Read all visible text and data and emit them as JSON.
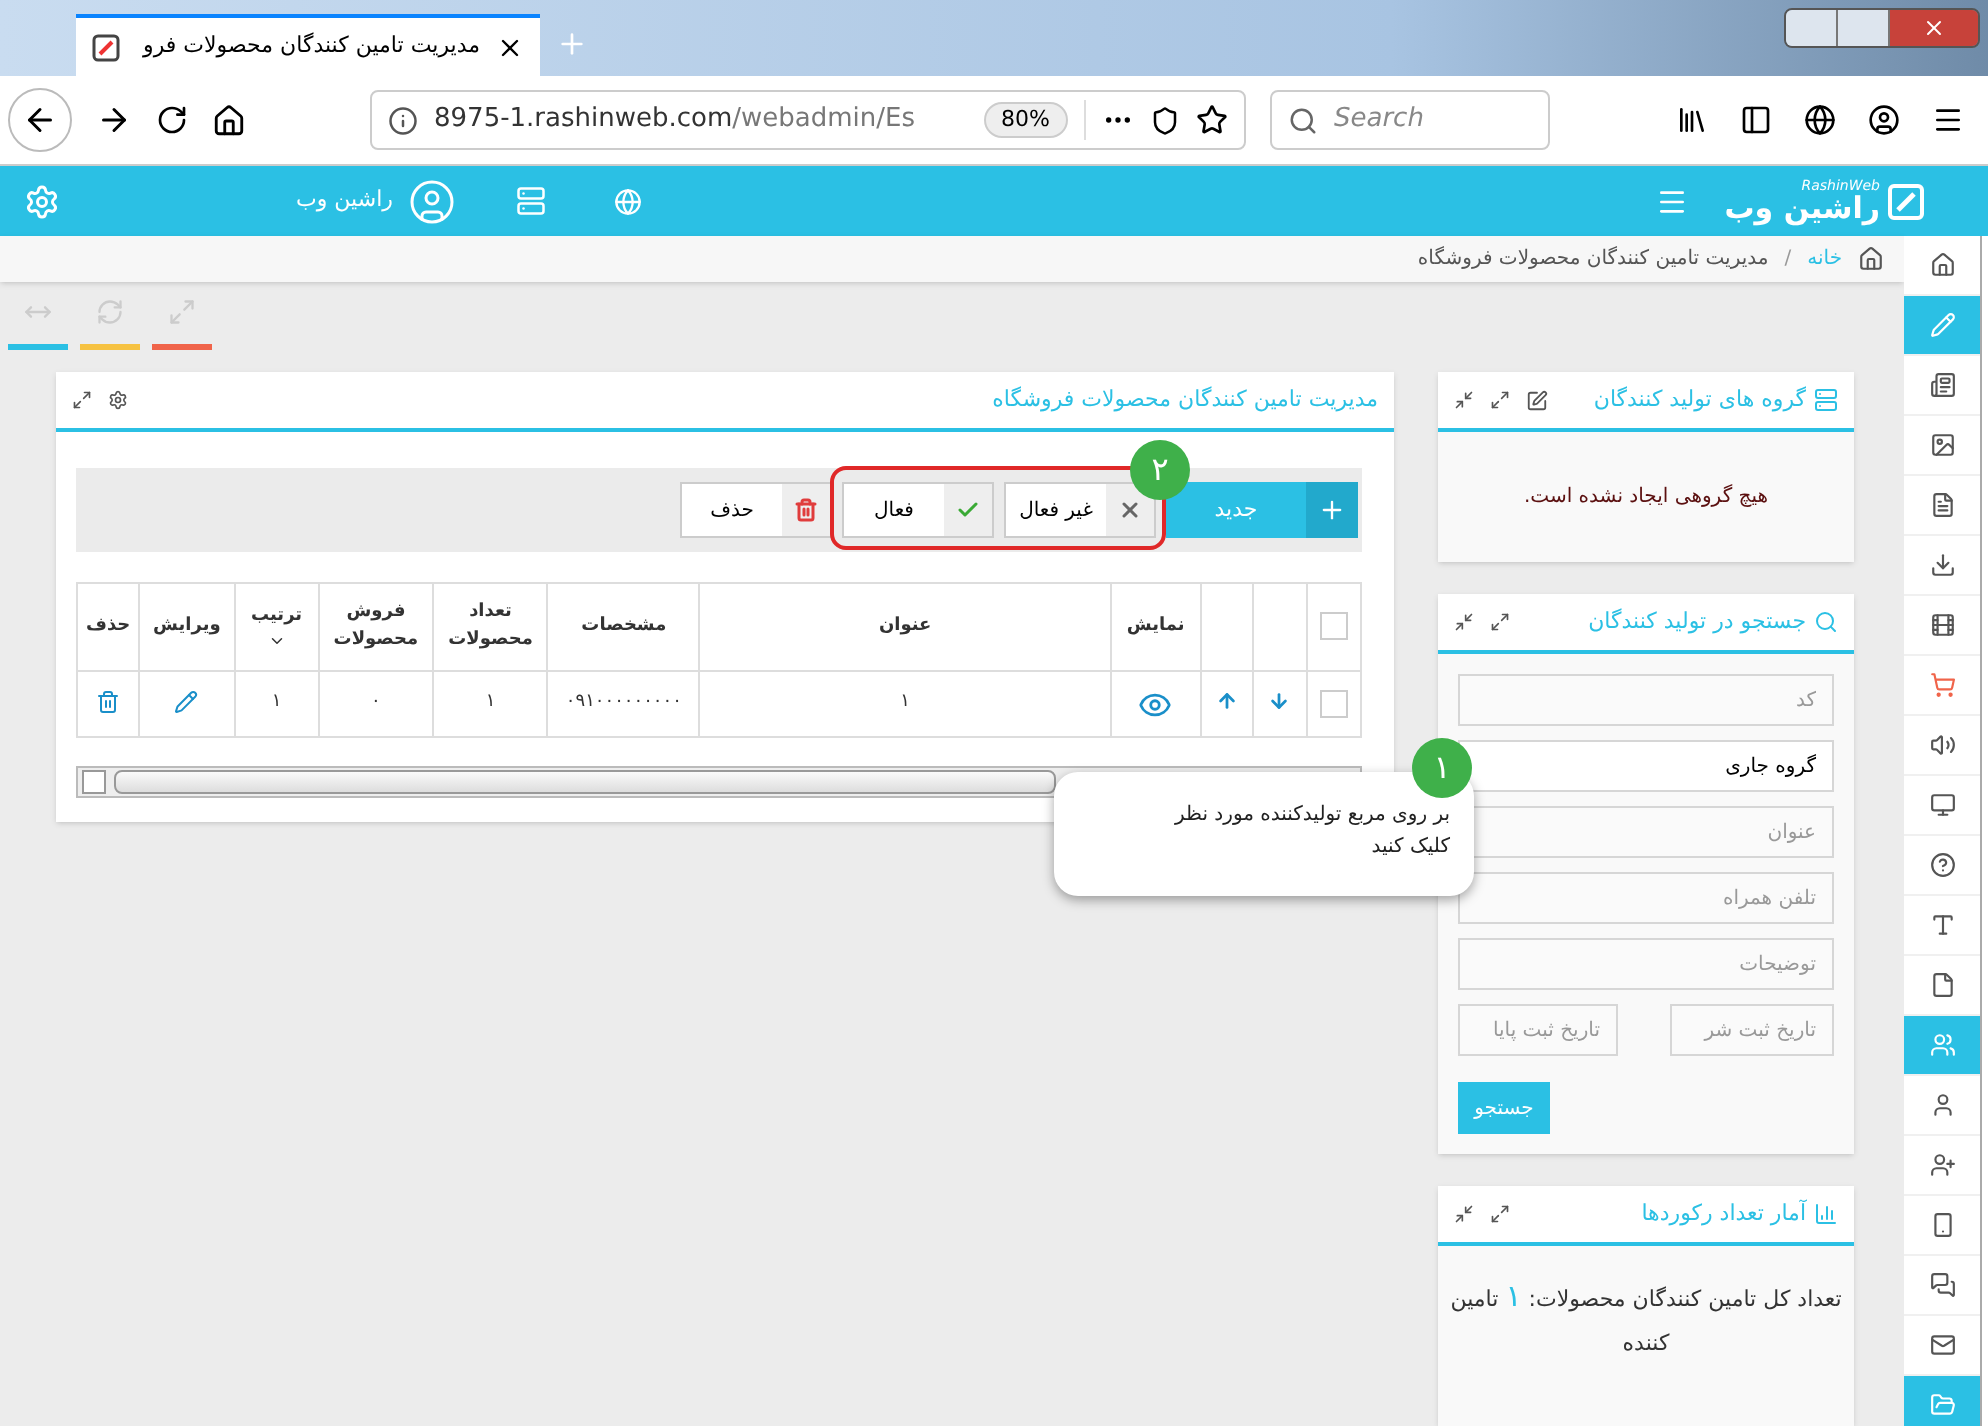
{
  "browser": {
    "tab_title": "مدیریت تامین کنندگان محصولات فرو",
    "url_host": "8975-1.rashinweb.com",
    "url_path": "/webadmin/Es",
    "zoom": "80%",
    "search_placeholder": "Search"
  },
  "header": {
    "logo_text": "راشین وب",
    "logo_sub": "RashinWeb",
    "user_name": "راشین وب"
  },
  "breadcrumb": {
    "home": "خانه",
    "separator": "/",
    "current": "مدیریت تامین کنندگان محصولات فروشگاه"
  },
  "toolbar": [
    {
      "kind": "arrows",
      "color": "#2bc0e4"
    },
    {
      "kind": "refresh",
      "color": "#f6c242"
    },
    {
      "kind": "expand",
      "color": "#f0644a"
    }
  ],
  "main_panel": {
    "title": "مدیریت تامین کنندگان محصولات فروشگاه",
    "actions": [
      {
        "kind": "new",
        "label": "جدید"
      },
      {
        "kind": "inactive",
        "label": "غیر فعال"
      },
      {
        "kind": "active",
        "label": "فعال"
      },
      {
        "kind": "delete",
        "label": "حذف"
      }
    ],
    "highlight_badge": "۲",
    "columns": [
      {
        "kind": "checkbox",
        "checked": false
      },
      {
        "kind": "blank"
      },
      {
        "kind": "blank"
      },
      {
        "kind": "text",
        "label": "نمایش"
      },
      {
        "kind": "text",
        "label": "عنوان"
      },
      {
        "kind": "text",
        "label": "مشخصات"
      },
      {
        "kind": "text",
        "label": "تعداد محصولات"
      },
      {
        "kind": "text",
        "label": "فروش محصولات"
      },
      {
        "kind": "sortable",
        "label": "ترتیب"
      },
      {
        "kind": "text",
        "label": "ویرایش"
      },
      {
        "kind": "text",
        "label": "حذف"
      }
    ],
    "rows": [
      {
        "checked": false,
        "title": "۱",
        "specs": "۰۹۱۰۰۰۰۰۰۰۰۰",
        "product_count": "۱",
        "sales": "۰",
        "order": "۱"
      }
    ]
  },
  "tooltip": {
    "badge": "۱",
    "text": "بر روی مربع تولیدکننده مورد نظر کلیک کنید"
  },
  "groups_panel": {
    "title": "گروه های تولید کنندگان",
    "message": "هیچ گروهی ایجاد نشده است."
  },
  "search_panel": {
    "title": "جستجو در تولید کنندگان",
    "code_placeholder": "کد",
    "group_value": "گروه جاری",
    "title_placeholder": "عنوان",
    "mobile_placeholder": "تلفن همراه",
    "notes_placeholder": "توضیحات",
    "date_from_placeholder": "تاریخ ثبت شر",
    "date_to_placeholder": "تاریخ ثبت پایا",
    "button": "جستجو"
  },
  "stats_panel": {
    "title": "آمار تعداد رکوردها",
    "text_before": "تعداد کل تامین کنندگان محصولات:",
    "count": "۱",
    "text_after": "تامین کننده"
  },
  "sidebar": [
    {
      "kind": "home",
      "selected": false
    },
    {
      "kind": "pencil",
      "selected": true
    },
    {
      "kind": "news",
      "selected": false
    },
    {
      "kind": "image",
      "selected": false
    },
    {
      "kind": "document",
      "selected": false
    },
    {
      "kind": "download",
      "selected": false
    },
    {
      "kind": "film",
      "selected": false
    },
    {
      "kind": "cart",
      "selected": false
    },
    {
      "kind": "sound",
      "selected": false
    },
    {
      "kind": "monitor",
      "selected": false
    },
    {
      "kind": "help",
      "selected": false
    },
    {
      "kind": "text",
      "selected": false
    },
    {
      "kind": "file",
      "selected": false
    },
    {
      "kind": "users",
      "selected": true
    },
    {
      "kind": "user",
      "selected": false
    },
    {
      "kind": "user-plus",
      "selected": false
    },
    {
      "kind": "phone",
      "selected": false
    },
    {
      "kind": "chat",
      "selected": false
    },
    {
      "kind": "mail",
      "selected": false
    },
    {
      "kind": "folder",
      "selected": true
    }
  ]
}
